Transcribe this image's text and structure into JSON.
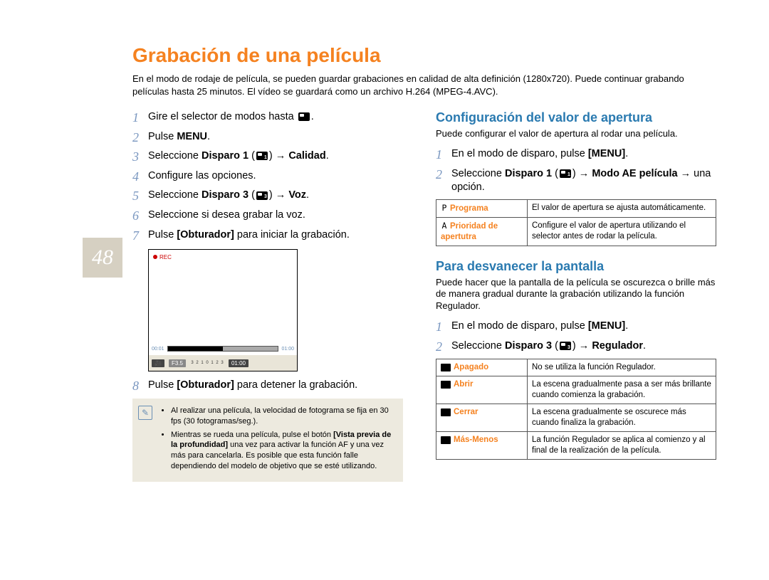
{
  "page_number": "48",
  "title": "Grabación de una película",
  "intro": "En el modo de rodaje de película, se pueden guardar grabaciones en calidad de alta definición (1280x720). Puede continuar grabando películas hasta 25 minutos. El vídeo se guardará como un archivo H.264 (MPEG-4.AVC).",
  "left": {
    "steps": [
      {
        "n": "1",
        "text": "Gire el selector de modos hasta ",
        "tail_icon": true,
        "tail_text": "."
      },
      {
        "n": "2",
        "pre": "Pulse ",
        "bold": "MENU",
        "post": "."
      },
      {
        "n": "3",
        "pre": "Seleccione ",
        "bold": "Disparo 1",
        "mid": " (",
        "icon": "sub1",
        "mid2": ")  → ",
        "bold2": "Calidad",
        "post": "."
      },
      {
        "n": "4",
        "text": "Configure las opciones."
      },
      {
        "n": "5",
        "pre": "Seleccione ",
        "bold": "Disparo 3",
        "mid": " (",
        "icon": "sub3",
        "mid2": ")  → ",
        "bold2": "Voz",
        "post": "."
      },
      {
        "n": "6",
        "text": "Seleccione si desea grabar la voz."
      },
      {
        "n": "7",
        "pre": "Pulse ",
        "bold": "[Obturador]",
        "post": " para iniciar la grabación."
      },
      {
        "n": "8",
        "pre": "Pulse ",
        "bold": "[Obturador]",
        "post": " para detener la grabación."
      }
    ],
    "lcd": {
      "rec": "REC",
      "time_left": "00:01",
      "time_right": "01:00",
      "f": "F3.5",
      "scale": [
        "3",
        "2",
        "1",
        "0",
        "1",
        "2",
        "3"
      ],
      "dur": "01:00"
    },
    "notes": [
      "Al realizar una película, la velocidad de fotograma se fija en 30 fps (30 fotogramas/seg.).",
      "Mientras se rueda una película, pulse el botón [Vista previa de la profundidad] una vez para activar la función AF y una vez más para cancelarla. Es posible que esta función falle dependiendo del modelo de objetivo que se esté utilizando."
    ],
    "note_bold": "[Vista previa de la profundidad]"
  },
  "right": {
    "sec1": {
      "title": "Configuración del valor de apertura",
      "intro": "Puede configurar el valor de apertura al rodar una película.",
      "steps": [
        {
          "n": "1",
          "pre": "En el modo de disparo, pulse ",
          "bold": "[MENU]",
          "post": "."
        },
        {
          "n": "2",
          "pre": "Seleccione ",
          "bold": "Disparo 1",
          "mid": " (",
          "icon": "sub1",
          "mid2": ") → ",
          "bold2": "Modo AE película",
          "post": "  → una opción."
        }
      ],
      "table": [
        {
          "sym": "P",
          "name": "Programa",
          "desc": "El valor de apertura se ajusta automáticamente."
        },
        {
          "sym": "A",
          "name": "Prioridad de apertutra",
          "desc": "Configure el valor de apertura utilizando el selector antes de rodar la película."
        }
      ]
    },
    "sec2": {
      "title": "Para desvanecer la pantalla",
      "intro": "Puede hacer que la pantalla de la película se oscurezca o brille más de manera gradual durante la grabación utilizando la función Regulador.",
      "steps": [
        {
          "n": "1",
          "pre": "En el modo de disparo, pulse ",
          "bold": "[MENU]",
          "post": "."
        },
        {
          "n": "2",
          "pre": "Seleccione ",
          "bold": "Disparo 3",
          "mid": " (",
          "icon": "sub3",
          "mid2": ") → ",
          "bold2": "Regulador",
          "post": "."
        }
      ],
      "table": [
        {
          "name": "Apagado",
          "desc": "No se utiliza la función Regulador."
        },
        {
          "name": "Abrir",
          "desc": "La escena gradualmente pasa a ser más brillante cuando comienza la grabación."
        },
        {
          "name": "Cerrar",
          "desc": "La escena gradualmente se oscurece más cuando finaliza la grabación."
        },
        {
          "name": "Más-Menos",
          "desc": "La función Regulador se aplica al comienzo y al final de la realización de la película."
        }
      ]
    }
  }
}
